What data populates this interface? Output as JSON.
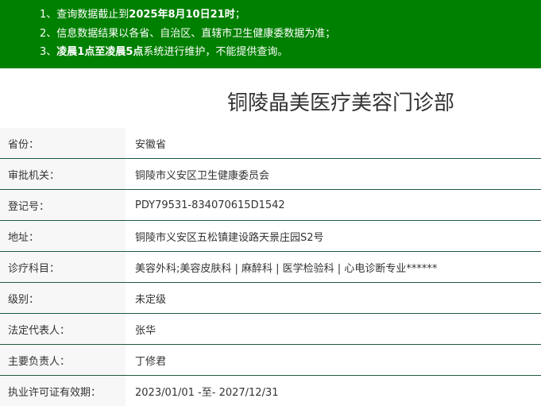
{
  "notice": {
    "line1_prefix": "1、查询数据截止到",
    "line1_bold": "2025年8月10日21时",
    "line1_suffix": "；",
    "line2": "2、信息数据结果以各省、自治区、直辖市卫生健康委数据为准；",
    "line3_prefix": "3、",
    "line3_bold": "凌晨1点至凌晨5点",
    "line3_suffix": "系统进行维护，不能提供查询。"
  },
  "page": {
    "title": "铜陵晶美医疗美容门诊部"
  },
  "details": [
    {
      "label": "省份：",
      "value": "安徽省"
    },
    {
      "label": "审批机关：",
      "value": "铜陵市义安区卫生健康委员会"
    },
    {
      "label": "登记号：",
      "value": "PDY79531-834070615D1542"
    },
    {
      "label": "地址：",
      "value": "铜陵市义安区五松镇建设路天景庄园S2号"
    },
    {
      "label": "诊疗科目：",
      "value": "美容外科;美容皮肤科 | 麻醉科 | 医学检验科 | 心电诊断专业******"
    },
    {
      "label": "级别：",
      "value": "未定级"
    },
    {
      "label": "法定代表人：",
      "value": "张华"
    },
    {
      "label": "主要负责人：",
      "value": "丁修君"
    },
    {
      "label": "执业许可证有效期：",
      "value": "2023/01/01 -至- 2027/12/31"
    }
  ],
  "colors": {
    "notice_background": "#008000",
    "row_divider": "#1f5b3d",
    "label_background": "#f7f7f7"
  }
}
